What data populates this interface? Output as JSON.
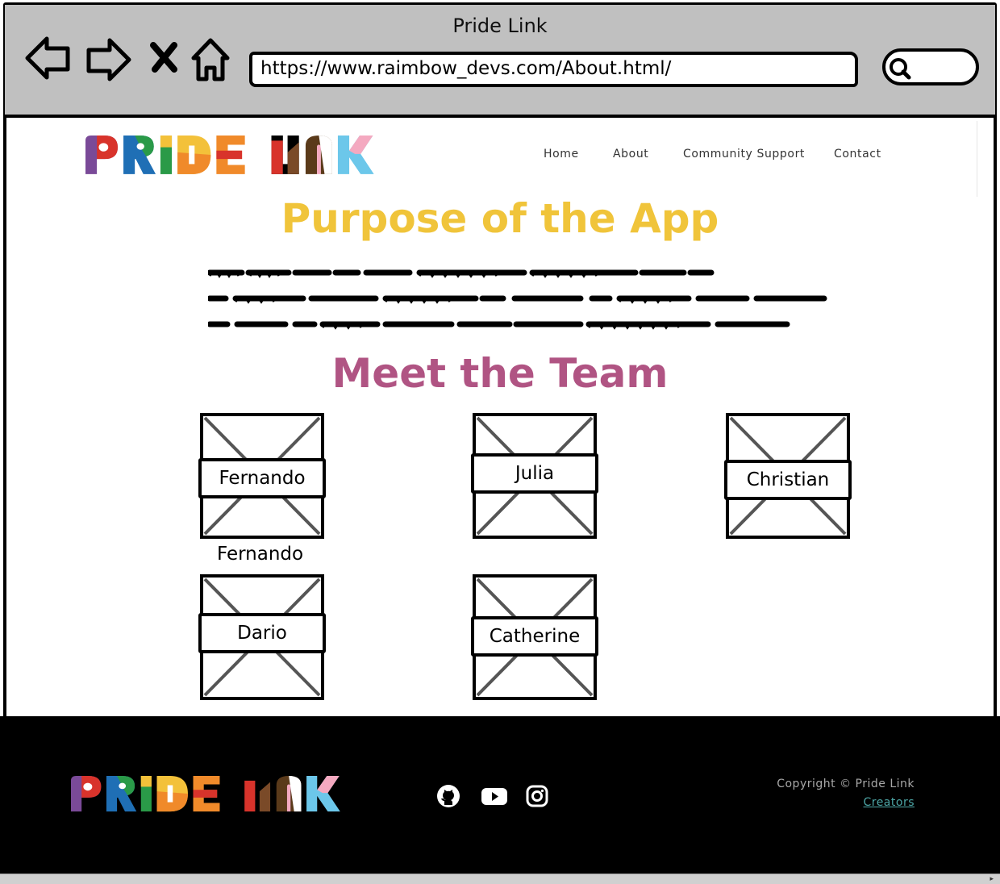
{
  "window": {
    "title": "Pride Link"
  },
  "browser": {
    "url": "https://www.raimbow_devs.com/About.html/",
    "icons": [
      "back-arrow-icon",
      "forward-arrow-icon",
      "close-x-icon",
      "home-icon",
      "search-icon"
    ]
  },
  "header": {
    "logo_alt": "PRIDE LINK",
    "nav": [
      {
        "label": "Home"
      },
      {
        "label": "About"
      },
      {
        "label": "Community Support"
      },
      {
        "label": "Contact"
      }
    ]
  },
  "purpose": {
    "title": "Purpose of the App"
  },
  "team": {
    "title": "Meet the Team",
    "members": [
      {
        "name": "Fernando",
        "caption": "Fernando"
      },
      {
        "name": "Julia"
      },
      {
        "name": "Christian"
      },
      {
        "name": "Dario"
      },
      {
        "name": "Catherine"
      }
    ]
  },
  "footer": {
    "logo_alt": "PRIDE LINK",
    "social_icons": [
      "github-icon",
      "youtube-icon",
      "instagram-icon"
    ],
    "copyright": "Copyright © Pride Link",
    "creators": "Creators"
  },
  "colors": {
    "purpose_title": "#f0c43a",
    "team_title": "#b05483",
    "chrome": "#c0c0c0",
    "footer_bg": "#000000",
    "creators_link": "#4da6a6"
  }
}
